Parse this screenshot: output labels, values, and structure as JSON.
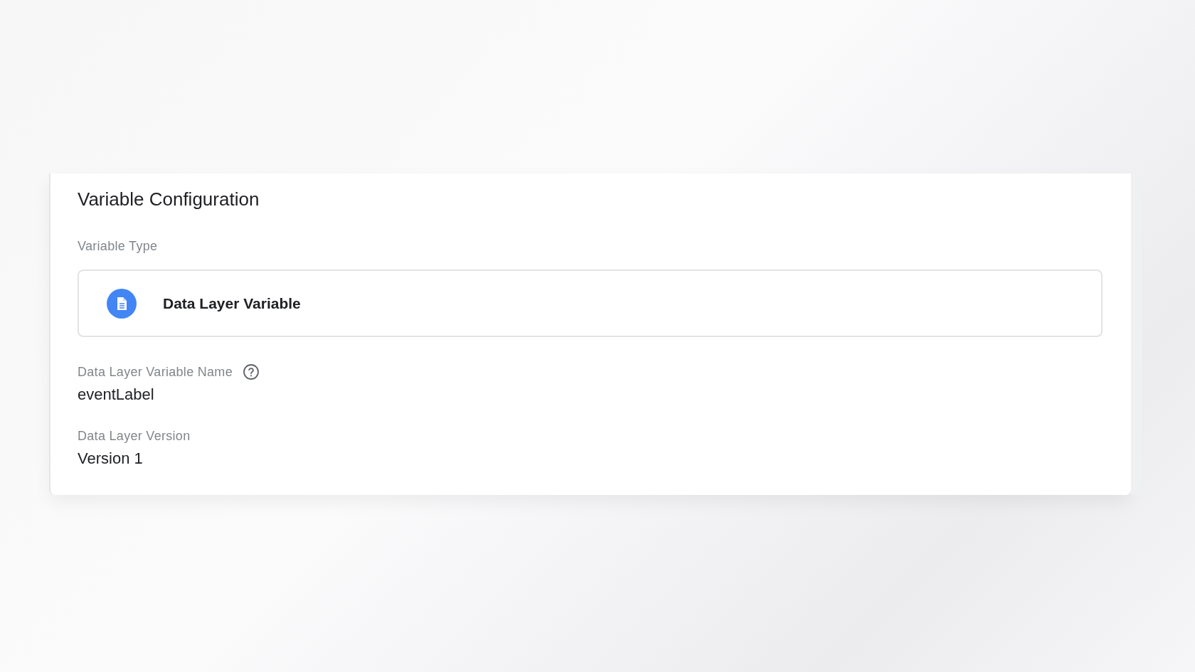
{
  "panel": {
    "title": "Variable Configuration",
    "variable_type": {
      "label": "Variable Type",
      "value": "Data Layer Variable"
    },
    "fields": [
      {
        "label": "Data Layer Variable Name",
        "value": "eventLabel",
        "help": true
      },
      {
        "label": "Data Layer Version",
        "value": "Version 1",
        "help": false
      }
    ]
  }
}
